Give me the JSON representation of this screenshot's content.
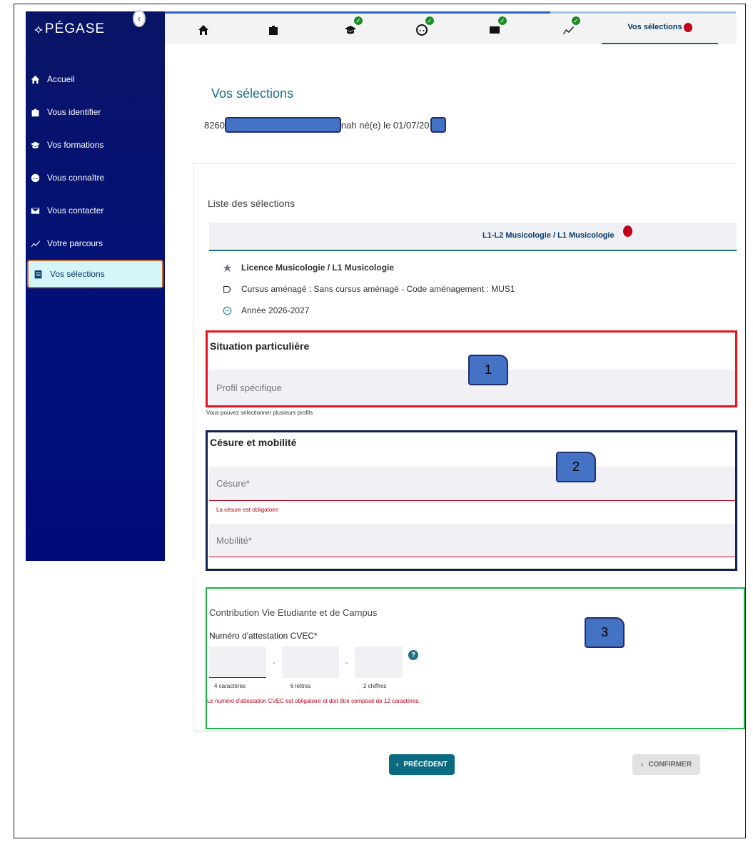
{
  "app": {
    "logo": "PÉGASE",
    "logo_mark": "⟡"
  },
  "sidebar": {
    "items": [
      {
        "label": "Accueil",
        "icon": "home-icon"
      },
      {
        "label": "Vous identifier",
        "icon": "id-badge-icon"
      },
      {
        "label": "Vos formations",
        "icon": "graduation-cap-icon"
      },
      {
        "label": "Vous connaître",
        "icon": "face-icon"
      },
      {
        "label": "Vous contacter",
        "icon": "envelope-icon"
      },
      {
        "label": "Votre parcours",
        "icon": "trend-icon"
      },
      {
        "label": "Vos sélections",
        "icon": "list-icon",
        "active": true
      }
    ]
  },
  "topbar": {
    "active_tab": "Vos sélections"
  },
  "page": {
    "title": "Vos sélections",
    "identity_prefix": "8260",
    "identity_middle": "nah né(e) le 01/07/20"
  },
  "selections": {
    "list_title": "Liste des sélections",
    "tab_label": "L1-L2 Musicologie / L1 Musicologie",
    "formation": "Licence Musicologie / L1 Musicologie",
    "cursus": "Cursus aménagé : Sans cursus aménagé  -  Code aménagement : MUS1",
    "year": "Année 2026-2027"
  },
  "situation": {
    "title": "Situation particulière",
    "profile_placeholder": "Profil spécifique",
    "hint": "Vous pouvez sélectionner plusieurs profils"
  },
  "cesure": {
    "title": "Césure et mobilité",
    "cesure_placeholder": "Césure*",
    "cesure_error": "La césure est obligatoire",
    "mobilite_placeholder": "Mobilité*"
  },
  "cvec": {
    "title": "Contribution Vie Etudiante et de Campus",
    "label": "Numéro d'attestation CVEC*",
    "hint1": "4 caractères",
    "hint2": "6 lettres",
    "hint3": "2 chiffres",
    "separator": "-",
    "help": "?",
    "error": "Le numéro d'attestation CVEC est obligatoire et doit être composé de 12 caractères."
  },
  "markers": [
    "1",
    "2",
    "3"
  ],
  "buttons": {
    "prev": "PRÉCÉDENT",
    "confirm": "CONFIRMER"
  },
  "colors": {
    "primary": "#0a6b80",
    "sidebar": "#00107a",
    "error": "#c0001a",
    "check": "#1c8a2b"
  }
}
